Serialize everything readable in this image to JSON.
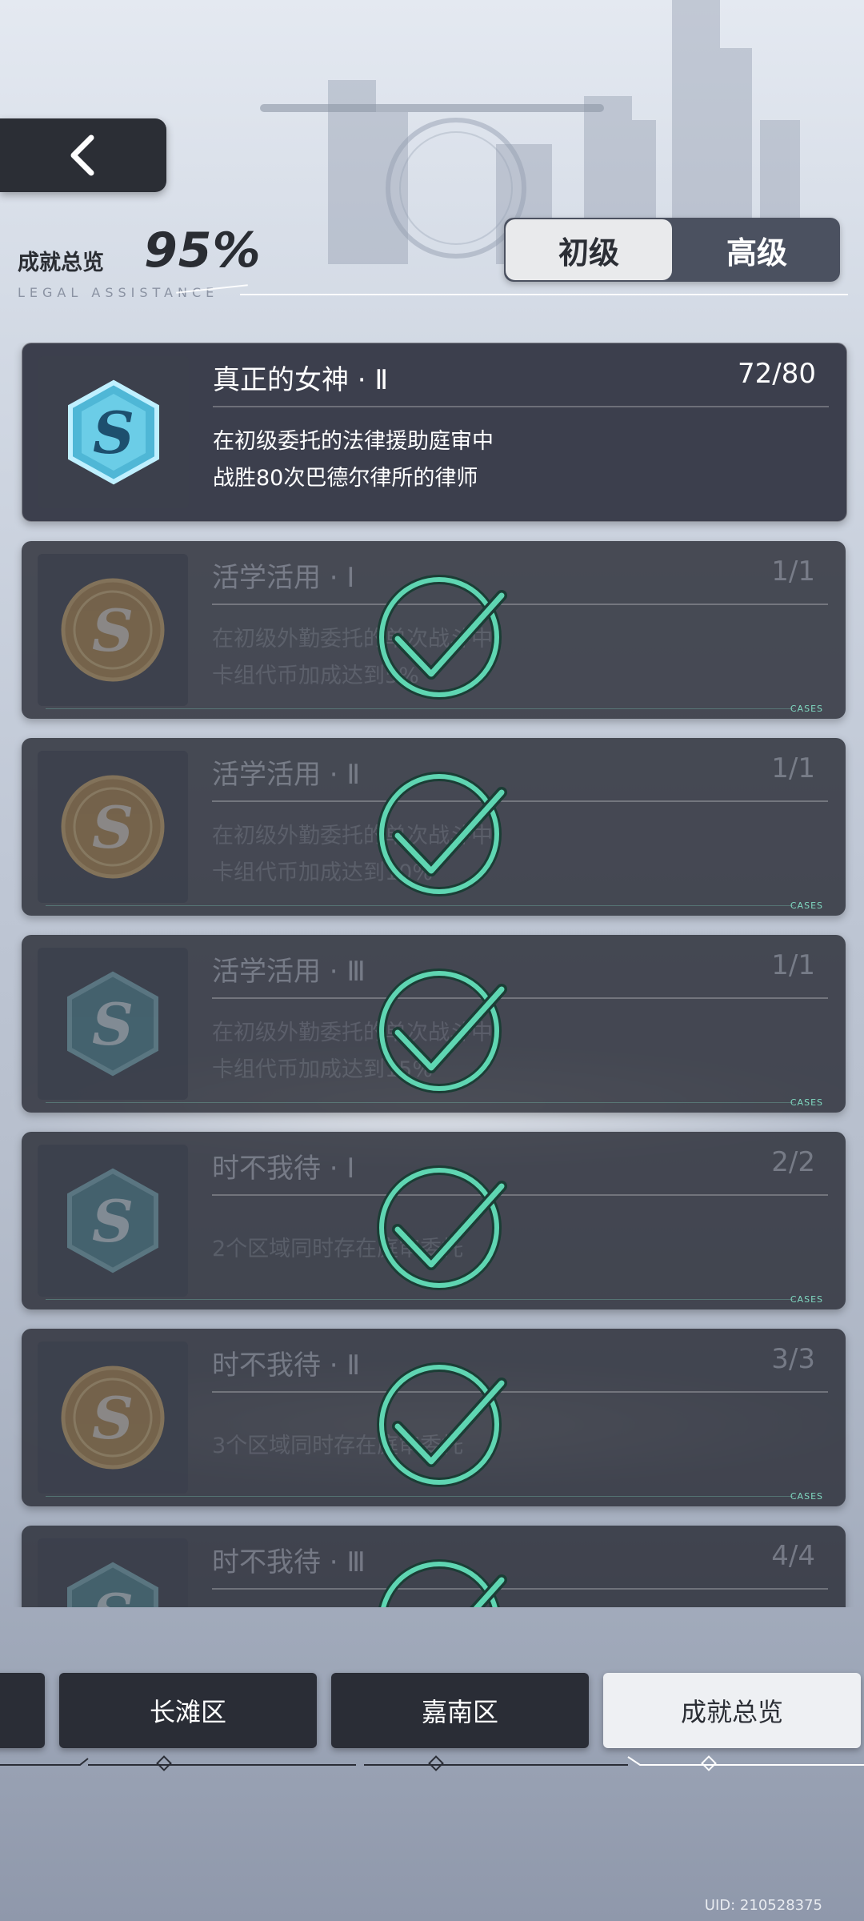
{
  "header": {
    "overview_label": "成就总览",
    "overview_percent": "95%",
    "overview_subtitle": "LEGAL ASSISTANCE",
    "back_icon": "chevron-left-icon"
  },
  "tier_tabs": [
    {
      "label": "初级",
      "selected": true
    },
    {
      "label": "高级",
      "selected": false
    }
  ],
  "achievements": [
    {
      "title": "真正的女神 · Ⅱ",
      "progress": "72/80",
      "desc_line1": "在初级委托的法律援助庭审中",
      "desc_line2": "战胜80次巴德尔律所的律师",
      "badge": "s-hexagon-badge-blue",
      "completed": false
    },
    {
      "title": "活学活用 · Ⅰ",
      "progress": "1/1",
      "desc_line1": "在初级外勤委托的单次战斗中，",
      "desc_line2": "卡组代币加成达到5%",
      "badge": "s-coin-badge-bronze",
      "completed": true
    },
    {
      "title": "活学活用 · Ⅱ",
      "progress": "1/1",
      "desc_line1": "在初级外勤委托的单次战斗中，",
      "desc_line2": "卡组代币加成达到10%",
      "badge": "s-coin-badge-bronze",
      "completed": true
    },
    {
      "title": "活学活用 · Ⅲ",
      "progress": "1/1",
      "desc_line1": "在初级外勤委托的单次战斗中，",
      "desc_line2": "卡组代币加成达到15%",
      "badge": "s-hexagon-badge-teal",
      "completed": true
    },
    {
      "title": "时不我待 · Ⅰ",
      "progress": "2/2",
      "desc_line1": "2个区域同时存在庭审委托",
      "desc_line2": "",
      "badge": "s-hexagon-badge-teal",
      "completed": true
    },
    {
      "title": "时不我待 · Ⅱ",
      "progress": "3/3",
      "desc_line1": "3个区域同时存在庭审委托",
      "desc_line2": "",
      "badge": "s-coin-badge-bronze",
      "completed": true
    },
    {
      "title": "时不我待 · Ⅲ",
      "progress": "4/4",
      "desc_line1": "",
      "desc_line2": "",
      "badge": "s-hexagon-badge-teal",
      "completed": true
    }
  ],
  "cases_tag": "CASES",
  "bottom_tabs": [
    {
      "label": "",
      "selected": false
    },
    {
      "label": "长滩区",
      "selected": false
    },
    {
      "label": "嘉南区",
      "selected": false
    },
    {
      "label": "成就总览",
      "selected": true
    }
  ],
  "uid": "UID: 210528375",
  "colors": {
    "card_bg": "#2b2e38",
    "check_green": "#5fd6b2",
    "bronze": "#b98d4a",
    "blue_badge": "#6fd0e8",
    "teal_badge": "#4f8b96"
  }
}
